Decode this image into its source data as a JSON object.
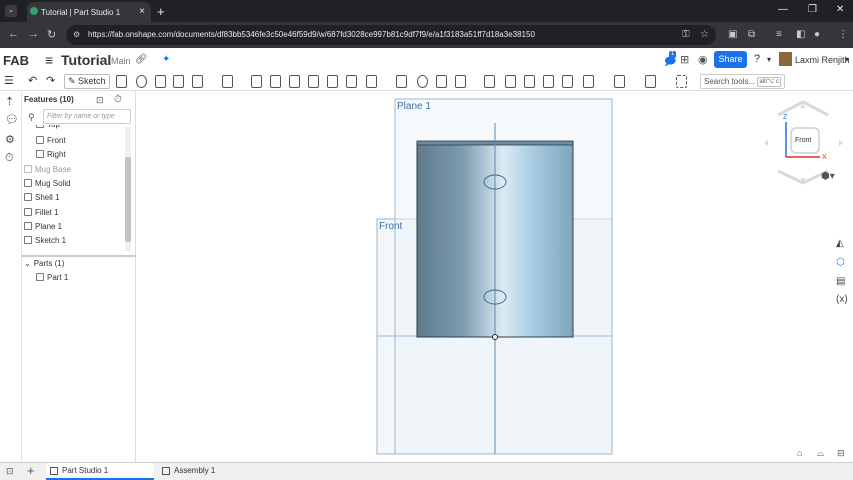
{
  "browser": {
    "tab_title": "Tutorial | Part Studio 1",
    "url": "https://fab.onshape.com/documents/df83bb5346fe3c50e46f59d9/w/687fd3028ce997b81c9df7f9/e/a1f3183a51ff7d18a3e38150",
    "new_tab": "+",
    "close_tab": "×"
  },
  "app": {
    "logo": "FAB",
    "document_title": "Tutorial",
    "branch": "Main",
    "share_label": "Share",
    "user_name": "Laxmi Renjith",
    "notification_count": "1"
  },
  "toolbar": {
    "sketch_label": "Sketch",
    "search_tools_placeholder": "Search tools...",
    "search_tools_shortcut": "alt/⌥ c"
  },
  "features": {
    "header": "Features (10)",
    "filter_placeholder": "Filter by name or type",
    "items": [
      {
        "label": "Top",
        "suppressed": false
      },
      {
        "label": "Front",
        "suppressed": false
      },
      {
        "label": "Right",
        "suppressed": false
      },
      {
        "label": "Mug Base",
        "suppressed": true
      },
      {
        "label": "Mug Solid",
        "suppressed": false
      },
      {
        "label": "Shell 1",
        "suppressed": false
      },
      {
        "label": "Fillet 1",
        "suppressed": false
      },
      {
        "label": "Plane 1",
        "suppressed": false
      },
      {
        "label": "Sketch 1",
        "suppressed": false
      }
    ],
    "parts_header": "Parts (1)",
    "parts": [
      "Part 1"
    ]
  },
  "viewport": {
    "plane_labels": [
      "Plane 1",
      "Front"
    ],
    "view_cube": {
      "face": "Front",
      "axis_z": "Z",
      "axis_x": "X"
    }
  },
  "bottom_tabs": [
    "Part Studio 1",
    "Assembly 1"
  ],
  "colors": {
    "accent": "#1a73e8",
    "plane_fill": "#eef3f8",
    "plane_border": "#9ab6d4",
    "plane_label": "#3a6ea5"
  }
}
